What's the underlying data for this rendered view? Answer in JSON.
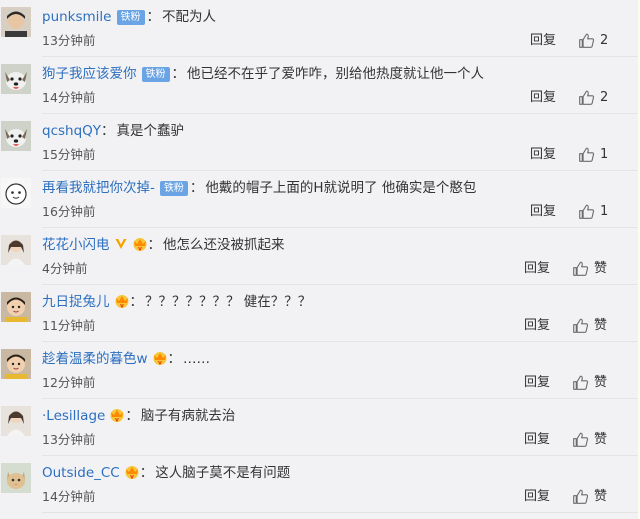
{
  "comments": [
    {
      "user": "punksmile",
      "badge": "铁粉",
      "vip": false,
      "text": "不配为人",
      "time": "13分钟前",
      "reply": "回复",
      "like": "2",
      "avatar_icon": "avatar-boy-icon"
    },
    {
      "user": "狗子我应该爱你",
      "badge": "铁粉",
      "vip": false,
      "text": "他已经不在乎了爱咋咋，别给他热度就让他一个人",
      "time": "14分钟前",
      "reply": "回复",
      "like": "2",
      "avatar_icon": "avatar-dog-icon"
    },
    {
      "user": "qcshqQY",
      "badge": null,
      "vip": false,
      "text": "真是个蠢驴",
      "time": "15分钟前",
      "reply": "回复",
      "like": "1",
      "avatar_icon": "avatar-dog-icon"
    },
    {
      "user": "再看我就把你次掉-",
      "badge": "铁粉",
      "vip": false,
      "text": "他戴的帽子上面的H就说明了 他确实是个憨包",
      "time": "16分钟前",
      "reply": "回复",
      "like": "1",
      "avatar_icon": "avatar-cartoon-icon"
    },
    {
      "user": "花花小闪电",
      "badge": null,
      "vip": true,
      "verified": true,
      "text": "他怎么还没被抓起来",
      "time": "4分钟前",
      "reply": "回复",
      "like": "赞",
      "avatar_icon": "avatar-person-icon"
    },
    {
      "user": "九日捉兔儿",
      "badge": null,
      "vip": true,
      "text": "？？？？？？？ 健在？？？",
      "time": "11分钟前",
      "reply": "回复",
      "like": "赞",
      "avatar_icon": "avatar-child-icon"
    },
    {
      "user": "趁着温柔的暮色w",
      "badge": null,
      "vip": true,
      "text": "……",
      "time": "12分钟前",
      "reply": "回复",
      "like": "赞",
      "avatar_icon": "avatar-child-icon"
    },
    {
      "user": "·Lesillage",
      "badge": null,
      "vip": true,
      "text": "脑子有病就去治",
      "time": "13分钟前",
      "reply": "回复",
      "like": "赞",
      "avatar_icon": "avatar-person-icon"
    },
    {
      "user": "Outside_CC",
      "badge": null,
      "vip": true,
      "text": "这人脑子莫不是有问题",
      "time": "14分钟前",
      "reply": "回复",
      "like": "赞",
      "avatar_icon": "avatar-cat-icon"
    }
  ],
  "colors": {
    "link": "#2c6fbf",
    "badge_bg": "#6aa4e4",
    "text": "#333333",
    "background": "#f2f2f5"
  }
}
